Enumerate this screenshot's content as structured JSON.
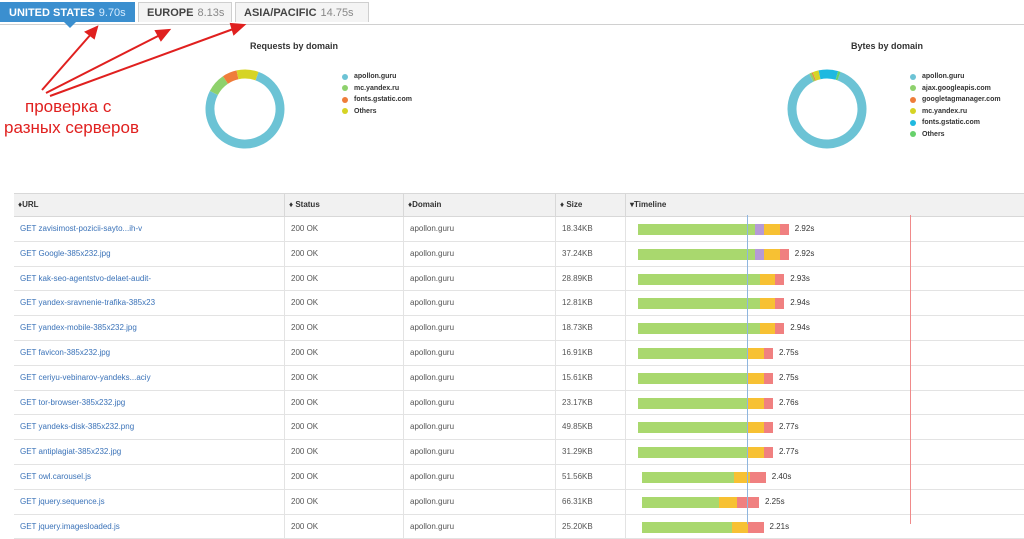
{
  "tabs": [
    {
      "region": "UNITED STATES",
      "time": "9.70s",
      "active": true
    },
    {
      "region": "EUROPE",
      "time": "8.13s",
      "active": false
    },
    {
      "region": "ASIA/PACIFIC",
      "time": "14.75s",
      "active": false
    }
  ],
  "annotation": {
    "line1": "проверка с",
    "line2": "разных серверов",
    "color": "#e0201f"
  },
  "requests_chart": {
    "title": "Requests by domain",
    "legend": [
      {
        "label": "apollon.guru",
        "color": "#6cc3d5"
      },
      {
        "label": "mc.yandex.ru",
        "color": "#8ed16c"
      },
      {
        "label": "fonts.gstatic.com",
        "color": "#ef7d3a"
      },
      {
        "label": "Others",
        "color": "#d6d424"
      }
    ],
    "fractions": [
      0.77,
      0.08,
      0.06,
      0.09
    ]
  },
  "bytes_chart": {
    "title": "Bytes by domain",
    "legend": [
      {
        "label": "apollon.guru",
        "color": "#6cc3d5"
      },
      {
        "label": "ajax.googleapis.com",
        "color": "#8ed16c"
      },
      {
        "label": "googletagmanager.com",
        "color": "#ef7d3a"
      },
      {
        "label": "mc.yandex.ru",
        "color": "#d6d424"
      },
      {
        "label": "fonts.gstatic.com",
        "color": "#1fb9e0"
      },
      {
        "label": "Others",
        "color": "#67d16b"
      }
    ],
    "fractions": [
      0.87,
      0.01,
      0.005,
      0.025,
      0.08,
      0.01
    ]
  },
  "columns": {
    "url": "URL",
    "status": "Status",
    "domain": "Domain",
    "size": "Size",
    "timeline": "Timeline"
  },
  "rows": [
    {
      "url": "GET zavisimost-pozicii-sayto...ih-v",
      "status": "200 OK",
      "domain": "apollon.guru",
      "size": "18.34KB",
      "time": "2.92s",
      "segs": [
        0.52,
        0.04,
        0.07,
        0.04
      ]
    },
    {
      "url": "GET Google-385x232.jpg",
      "status": "200 OK",
      "domain": "apollon.guru",
      "size": "37.24KB",
      "time": "2.92s",
      "segs": [
        0.52,
        0.04,
        0.07,
        0.04
      ]
    },
    {
      "url": "GET kak-seo-agentstvo-delaet-audit-",
      "status": "200 OK",
      "domain": "apollon.guru",
      "size": "28.89KB",
      "time": "2.93s",
      "segs": [
        0.54,
        0.0,
        0.07,
        0.04
      ]
    },
    {
      "url": "GET yandex-sravnenie-trafika-385x23",
      "status": "200 OK",
      "domain": "apollon.guru",
      "size": "12.81KB",
      "time": "2.94s",
      "segs": [
        0.54,
        0.0,
        0.07,
        0.04
      ]
    },
    {
      "url": "GET yandex-mobile-385x232.jpg",
      "status": "200 OK",
      "domain": "apollon.guru",
      "size": "18.73KB",
      "time": "2.94s",
      "segs": [
        0.54,
        0.0,
        0.07,
        0.04
      ]
    },
    {
      "url": "GET favicon-385x232.jpg",
      "status": "200 OK",
      "domain": "apollon.guru",
      "size": "16.91KB",
      "time": "2.75s",
      "segs": [
        0.49,
        0.0,
        0.07,
        0.04
      ]
    },
    {
      "url": "GET ceriyu-vebinarov-yandeks...aciy",
      "status": "200 OK",
      "domain": "apollon.guru",
      "size": "15.61KB",
      "time": "2.75s",
      "segs": [
        0.49,
        0.0,
        0.07,
        0.04
      ]
    },
    {
      "url": "GET tor-browser-385x232.jpg",
      "status": "200 OK",
      "domain": "apollon.guru",
      "size": "23.17KB",
      "time": "2.76s",
      "segs": [
        0.49,
        0.0,
        0.07,
        0.04
      ]
    },
    {
      "url": "GET yandeks-disk-385x232.png",
      "status": "200 OK",
      "domain": "apollon.guru",
      "size": "49.85KB",
      "time": "2.77s",
      "segs": [
        0.49,
        0.0,
        0.07,
        0.04
      ]
    },
    {
      "url": "GET antiplagiat-385x232.jpg",
      "status": "200 OK",
      "domain": "apollon.guru",
      "size": "31.29KB",
      "time": "2.77s",
      "segs": [
        0.49,
        0.0,
        0.07,
        0.04
      ]
    },
    {
      "url": "GET owl.carousel.js",
      "status": "200 OK",
      "domain": "apollon.guru",
      "size": "51.56KB",
      "time": "2.40s",
      "segs": [
        0.41,
        0.0,
        0.07,
        0.07
      ]
    },
    {
      "url": "GET jquery.sequence.js",
      "status": "200 OK",
      "domain": "apollon.guru",
      "size": "66.31KB",
      "time": "2.25s",
      "segs": [
        0.34,
        0.0,
        0.08,
        0.1
      ]
    },
    {
      "url": "GET jquery.imagesloaded.js",
      "status": "200 OK",
      "domain": "apollon.guru",
      "size": "25.20KB",
      "time": "2.21s",
      "segs": [
        0.4,
        0.0,
        0.07,
        0.07
      ]
    }
  ],
  "timeline_colors": {
    "wait": "#a9d86e",
    "connect": "#b59ad6",
    "ssl": "#f7c133",
    "receive": "#f08080"
  },
  "icons": {
    "sort": "sort-icon",
    "sort_desc": "sort-desc-icon"
  }
}
